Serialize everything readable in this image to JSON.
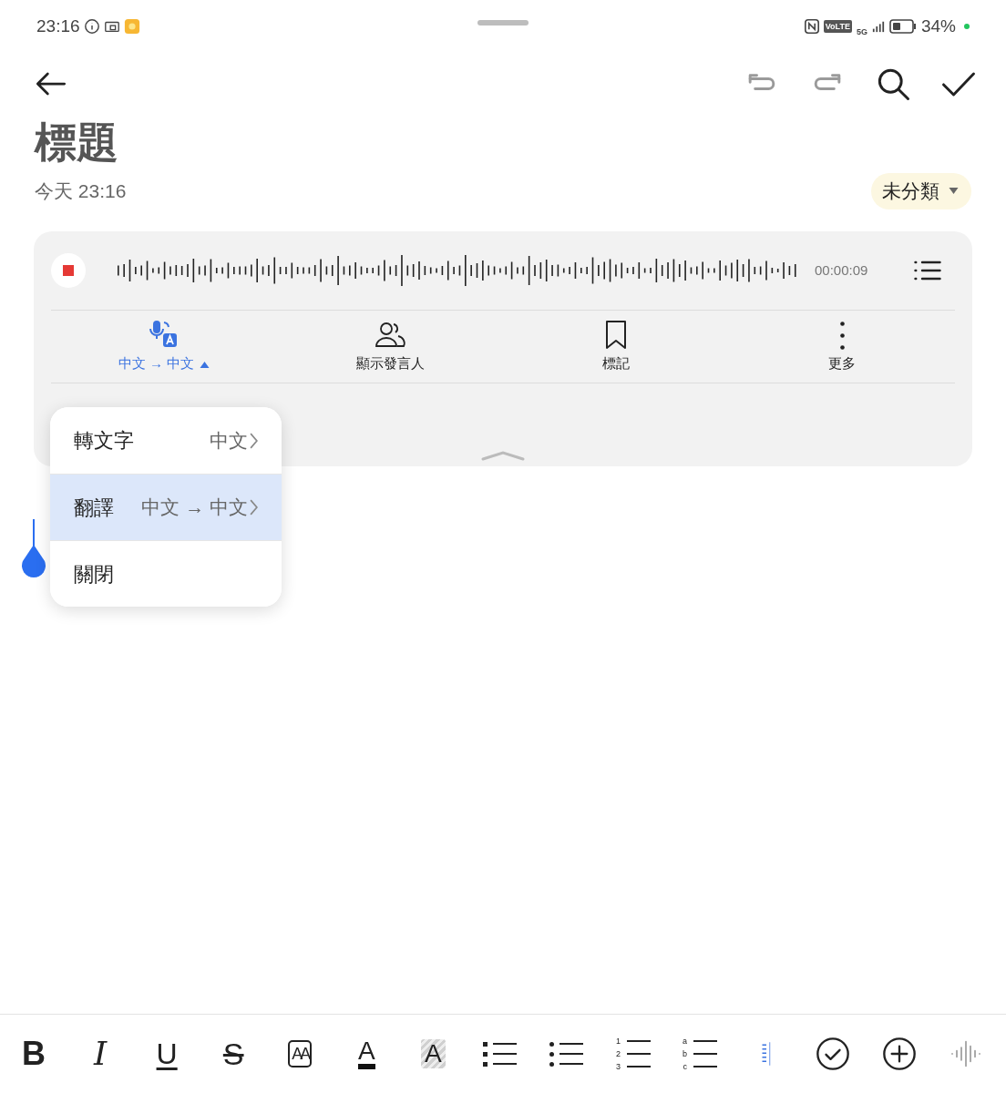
{
  "status_bar": {
    "time": "23:16",
    "volte": "VoLTE",
    "network": "5G",
    "battery": "34%"
  },
  "toolbar": {
    "actions": [
      {
        "kind": "undo",
        "disabled": true
      },
      {
        "kind": "redo",
        "disabled": true
      },
      {
        "kind": "search",
        "disabled": false
      },
      {
        "kind": "done",
        "disabled": false
      }
    ]
  },
  "note": {
    "title": "標題",
    "date": "今天 23:16",
    "category": "未分類"
  },
  "recorder": {
    "elapsed": "00:00:09",
    "actions": [
      {
        "kind": "transcribe",
        "label": "中文 → 中文",
        "active": true
      },
      {
        "kind": "speakers",
        "label": "顯示發言人",
        "active": false
      },
      {
        "kind": "bookmark",
        "label": "標記",
        "active": false
      },
      {
        "kind": "more",
        "label": "更多",
        "active": false
      }
    ]
  },
  "menu": [
    {
      "label": "轉文字",
      "value": "中文",
      "selected": false
    },
    {
      "label": "翻譯",
      "value": "中文 → 中文",
      "selected": true
    },
    {
      "label": "關閉",
      "selected": false
    }
  ],
  "format_bar": [
    {
      "kind": "bold",
      "glyph": "B"
    },
    {
      "kind": "italic",
      "glyph": "I"
    },
    {
      "kind": "underline",
      "glyph": "U"
    },
    {
      "kind": "strike",
      "glyph": "S"
    },
    {
      "kind": "fontsize",
      "glyph": "AA"
    },
    {
      "kind": "textcolor",
      "glyph": "A"
    },
    {
      "kind": "highlight",
      "glyph": "A"
    },
    {
      "kind": "squarelist"
    },
    {
      "kind": "dotlist"
    },
    {
      "kind": "numlist",
      "markers": [
        "1",
        "2",
        "3"
      ]
    },
    {
      "kind": "alphalist",
      "markers": [
        "a",
        "b",
        "c"
      ]
    },
    {
      "kind": "indent"
    },
    {
      "kind": "checklist"
    },
    {
      "kind": "add"
    },
    {
      "kind": "voice",
      "disabled": true
    }
  ]
}
